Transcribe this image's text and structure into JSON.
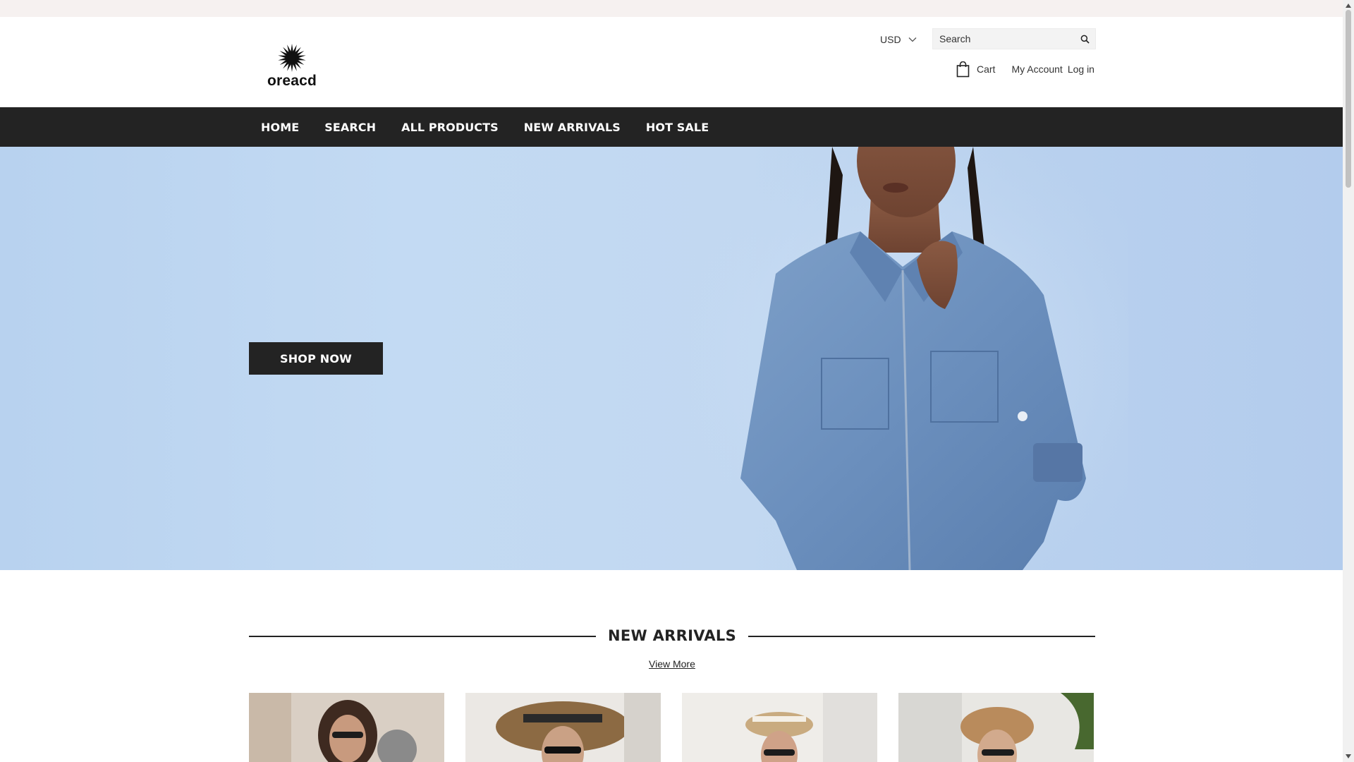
{
  "brand": {
    "name": "oreacd",
    "logo_icon": "starburst-icon"
  },
  "header": {
    "currency": "USD",
    "search_placeholder": "Search",
    "cart_label": "Cart",
    "account_label": "My Account",
    "login_label": "Log in"
  },
  "nav": {
    "items": [
      {
        "label": "HOME"
      },
      {
        "label": "SEARCH"
      },
      {
        "label": "ALL PRODUCTS"
      },
      {
        "label": "NEW ARRIVALS"
      },
      {
        "label": "HOT SALE"
      }
    ]
  },
  "hero": {
    "cta_label": "SHOP NOW",
    "background_color": "#c2d8f1",
    "image": "woman-in-denim-jacket"
  },
  "new_arrivals": {
    "title": "NEW ARRIVALS",
    "view_more_label": "View More",
    "products": [
      {
        "image": "woman-sunglasses-striped-top"
      },
      {
        "image": "woman-wide-brim-sunhat-red-top"
      },
      {
        "image": "woman-straw-hat-pink-top"
      },
      {
        "image": "woman-straw-hat-sunglasses"
      }
    ]
  },
  "colors": {
    "nav_bg": "#232323",
    "announcement_bg": "#f6f1f0",
    "button_bg": "#232323"
  }
}
